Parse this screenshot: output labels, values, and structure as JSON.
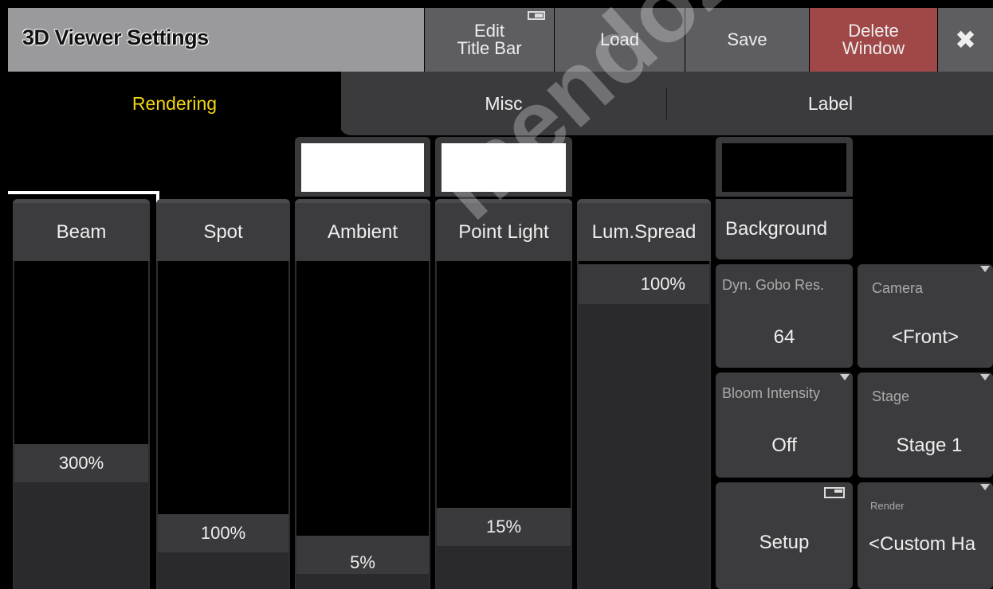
{
  "window": {
    "title": "3D Viewer Settings",
    "buttons": {
      "edit_title_bar": "Edit\nTitle Bar",
      "load": "Load",
      "save": "Save",
      "delete_window": "Delete\nWindow",
      "close": "✖"
    }
  },
  "tabs": [
    {
      "label": "Rendering",
      "active": true
    },
    {
      "label": "Misc",
      "active": false
    },
    {
      "label": "Label",
      "active": false
    }
  ],
  "faders": [
    {
      "label": "Beam",
      "value": "300%",
      "level": 0.33,
      "selected": true
    },
    {
      "label": "Spot",
      "value": "100%",
      "level": 0.11
    },
    {
      "label": "Ambient",
      "value": "5%",
      "level": 0.05
    },
    {
      "label": "Point Light",
      "value": "15%",
      "level": 0.2
    },
    {
      "label": "Lum.Spread",
      "value": "100%",
      "level": 1.0
    }
  ],
  "swatches": {
    "ambient_color": "#ffffff",
    "point_light_color": "#ffffff",
    "background_color": "#000000"
  },
  "right_panel": {
    "background_label": "Background",
    "dyn_gobo": {
      "label": "Dyn. Gobo Res.",
      "value": "64"
    },
    "camera": {
      "label": "Camera",
      "value": "<Front>"
    },
    "bloom": {
      "label": "Bloom Intensity",
      "value": "Off"
    },
    "stage": {
      "label": "Stage",
      "value": "Stage 1"
    },
    "setup": {
      "label": "Setup"
    },
    "render": {
      "label": "Render",
      "value": "<Custom Ha"
    }
  },
  "colors": {
    "accent_tab": "#f2d70f",
    "delete": "#a04848"
  },
  "watermark": "mendoza.com"
}
